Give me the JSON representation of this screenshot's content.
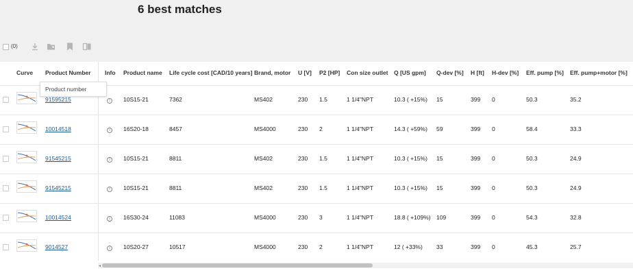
{
  "page": {
    "title": "6 best matches"
  },
  "toolbar": {
    "selected_count": "(0)",
    "icons": [
      "download-icon",
      "add-to-folder-icon",
      "bookmark-icon",
      "compare-icon"
    ]
  },
  "table": {
    "headers": {
      "curve": "Curve",
      "product_number": "Product Number",
      "info": "Info",
      "product_name": "Product name",
      "lcc": "Life cycle cost [CAD/10 years]",
      "brand": "Brand, motor",
      "u": "U [V]",
      "p2": "P2 [HP]",
      "con": "Con size outlet",
      "q": "Q [US gpm]",
      "qdev": "Q-dev [%]",
      "h": "H [ft]",
      "hdev": "H-dev [%]",
      "effpump": "Eff. pump [%]",
      "effpm": "Eff. pump+motor [%]"
    },
    "tooltip": "Product number",
    "rows": [
      {
        "product_number": "91595215",
        "product_name": "10S15-21",
        "lcc": "7362",
        "brand": "MS402",
        "u": "230",
        "p2": "1.5",
        "con": "1 1/4\"NPT",
        "q": "10.3 ( +15%)",
        "qdev": "15",
        "h": "399",
        "hdev": "0",
        "effpump": "50.3",
        "effpm": "35.2"
      },
      {
        "product_number": "10014518",
        "product_name": "16S20-18",
        "lcc": "8457",
        "brand": "MS4000",
        "u": "230",
        "p2": "2",
        "con": "1 1/4\"NPT",
        "q": "14.3 ( +59%)",
        "qdev": "59",
        "h": "399",
        "hdev": "0",
        "effpump": "58.4",
        "effpm": "33.3"
      },
      {
        "product_number": "91545215",
        "product_name": "10S15-21",
        "lcc": "8811",
        "brand": "MS402",
        "u": "230",
        "p2": "1.5",
        "con": "1 1/4\"NPT",
        "q": "10.3 ( +15%)",
        "qdev": "15",
        "h": "399",
        "hdev": "0",
        "effpump": "50.3",
        "effpm": "24.9"
      },
      {
        "product_number": "91545215",
        "product_name": "10S15-21",
        "lcc": "8811",
        "brand": "MS402",
        "u": "230",
        "p2": "1.5",
        "con": "1 1/4\"NPT",
        "q": "10.3 ( +15%)",
        "qdev": "15",
        "h": "399",
        "hdev": "0",
        "effpump": "50.3",
        "effpm": "24.9"
      },
      {
        "product_number": "10014524",
        "product_name": "16S30-24",
        "lcc": "11083",
        "brand": "MS4000",
        "u": "230",
        "p2": "3",
        "con": "1 1/4\"NPT",
        "q": "18.8 ( +109%)",
        "qdev": "109",
        "h": "399",
        "hdev": "0",
        "effpump": "54.3",
        "effpm": "32.8"
      },
      {
        "product_number": "9014527",
        "product_name": "10S20-27",
        "lcc": "10517",
        "brand": "MS4000",
        "u": "230",
        "p2": "2",
        "con": "1 1/4\"NPT",
        "q": "12 ( +33%)",
        "qdev": "33",
        "h": "399",
        "hdev": "0",
        "effpump": "45.3",
        "effpm": "25.7"
      }
    ]
  }
}
